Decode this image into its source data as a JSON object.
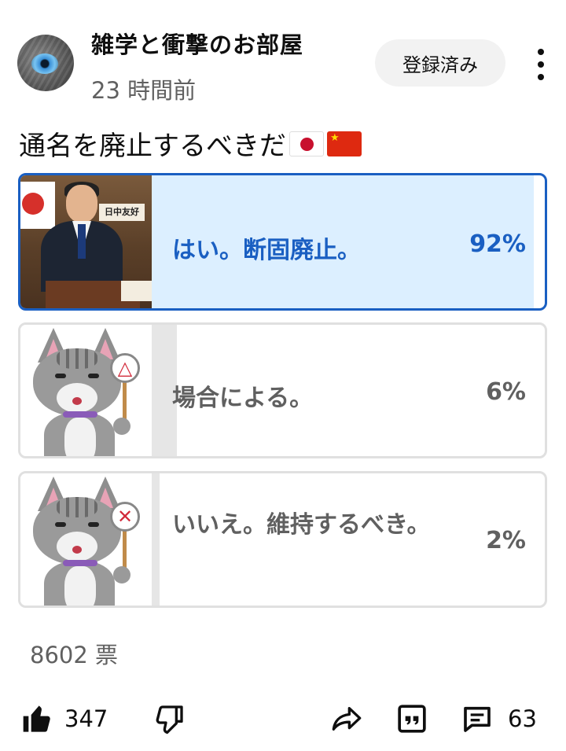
{
  "post": {
    "channel_name": "雑学と衝撃のお部屋",
    "timestamp": "23 時間前",
    "subscribed_label": "登録済み"
  },
  "poll": {
    "question": "通名を廃止するべきだ",
    "question_flags": [
      "japan-flag-icon",
      "china-flag-icon"
    ],
    "options": [
      {
        "label": "はい。断固廃止。",
        "percent_text": "92%",
        "percent": 92,
        "selected": true
      },
      {
        "label": "場合による。",
        "percent_text": "6%",
        "percent": 6,
        "selected": false
      },
      {
        "label": "いいえ。維持するべき。",
        "percent_text": "2%",
        "percent": 2,
        "selected": false
      }
    ],
    "option_images": {
      "politician_sign": "日中友好",
      "cat_signs": [
        "△",
        "✕"
      ]
    },
    "votes_text": "8602 票"
  },
  "actions": {
    "like_count": "347",
    "comment_count": "63",
    "icons": [
      "thumbs-up-icon",
      "thumbs-down-icon",
      "share-icon",
      "quote-icon",
      "comment-icon"
    ]
  },
  "colors": {
    "selected_border": "#1a5fc2",
    "selected_fill": "#dcefff",
    "selected_text": "#1a5fc2",
    "unselected_border": "#e0e0e0",
    "unselected_fill": "#e6e6e6",
    "unselected_text": "#606060"
  }
}
